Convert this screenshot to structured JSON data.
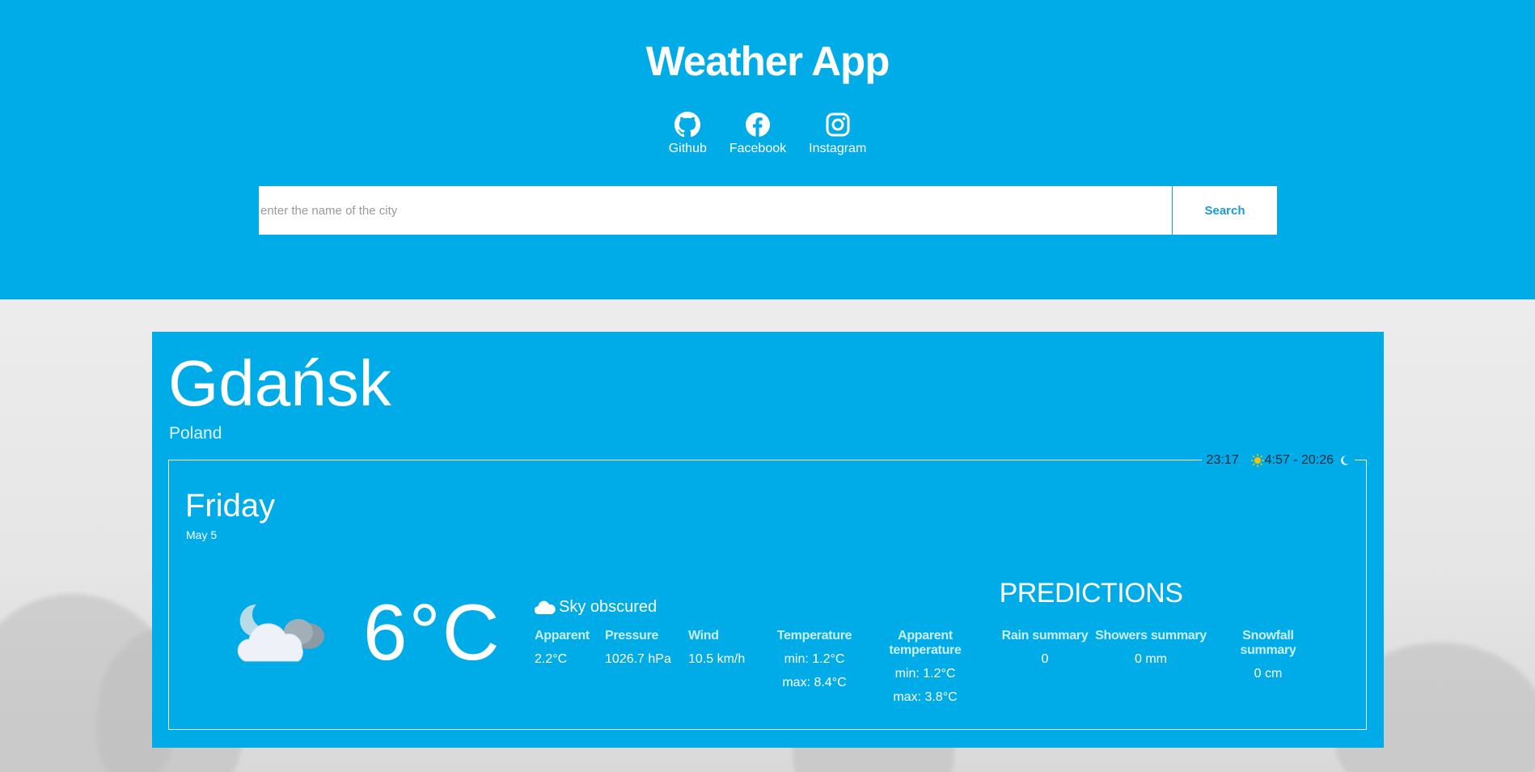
{
  "app": {
    "title": "Weather App"
  },
  "socials": [
    {
      "label": "Github",
      "icon": "github-icon"
    },
    {
      "label": "Facebook",
      "icon": "facebook-icon"
    },
    {
      "label": "Instagram",
      "icon": "instagram-icon"
    }
  ],
  "search": {
    "placeholder": "enter the name of the city",
    "value": "",
    "button_label": "Search"
  },
  "location": {
    "city": "Gdańsk",
    "country": "Poland"
  },
  "times": {
    "current": "23:17",
    "sun": "4:57 - 20:26"
  },
  "today": {
    "day": "Friday",
    "date": "May 5",
    "temperature": "6°C",
    "condition": "Sky obscured",
    "apparent_label": "Apparent",
    "apparent_value": "2.2°C",
    "pressure_label": "Pressure",
    "pressure_value": "1026.7 hPa",
    "wind_label": "Wind",
    "wind_value": "10.5 km/h"
  },
  "predictions": {
    "title": "PREDICTIONS",
    "temperature_label": "Temperature",
    "temperature_min": "min: 1.2°C",
    "temperature_max": "max: 8.4°C",
    "apparent_label": "Apparent temperature",
    "apparent_min": "min: 1.2°C",
    "apparent_max": "max: 3.8°C",
    "rain_label": "Rain summary",
    "rain_value": "0",
    "showers_label": "Showers summary",
    "showers_value": "0 mm",
    "snowfall_label": "Snowfall summary",
    "snowfall_value": "0 cm"
  },
  "colors": {
    "primary": "#00ace8",
    "background": "#e9e9e9",
    "text": "#ffffff"
  }
}
